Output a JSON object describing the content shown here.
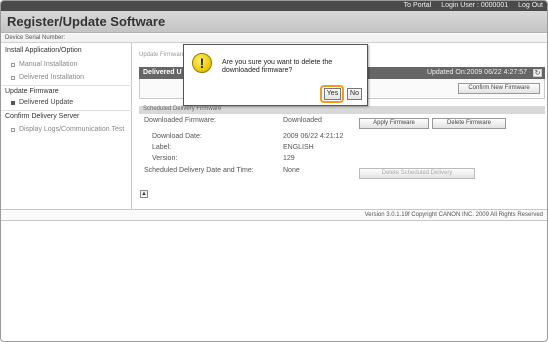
{
  "topbar": {
    "portal_link": "To Portal",
    "login_user": "Login User : 0000001",
    "logout": "Log Out"
  },
  "app": {
    "title": "Register/Update Software"
  },
  "serial": {
    "label": "Device Serial Number:"
  },
  "sidebar": {
    "install_head": "Install Application/Option",
    "manual_install": "Manual Installation",
    "delivered_install": "Delivered Installation",
    "update_head": "Update Firmware",
    "delivered_update": "Delivered Update",
    "confirm_head": "Confirm Delivery Server",
    "display_logs": "Display Logs/Communication Test"
  },
  "content": {
    "breadcrumb": "Update Firmware",
    "delivered_title": "Delivered U",
    "updated_on": "Updated On:2009 06/22 4:27:57",
    "confirm_new_btn": "Confirm New Firmware",
    "sched_title": "Scheduled Delivery Firmware",
    "downloaded_fw_label": "Downloaded Firmware:",
    "downloaded_fw_value": "Downloaded",
    "apply_btn": "Apply Firmware",
    "delete_btn": "Delete Firmware",
    "download_date_label": "Download Date:",
    "download_date_value": "2009 06/22 4:21:12",
    "label_label": "Label:",
    "label_value": "ENGLISH",
    "version_label": "Version:",
    "version_value": "129",
    "sched_dt_label": "Scheduled Delivery Date and Time:",
    "sched_dt_value": "None",
    "delete_sched_btn": "Delete Scheduled Delivery"
  },
  "footer": {
    "text": "Version 3.0.1.19f Copyright CANON INC. 2009 All Rights Reserved"
  },
  "dialog": {
    "message": "Are you sure you want to delete the downloaded firmware?",
    "yes": "Yes",
    "no": "No"
  },
  "colors": {
    "highlight": "#f39a1e",
    "header_bar": "#4a4a4a",
    "warning": "#e8c400"
  }
}
